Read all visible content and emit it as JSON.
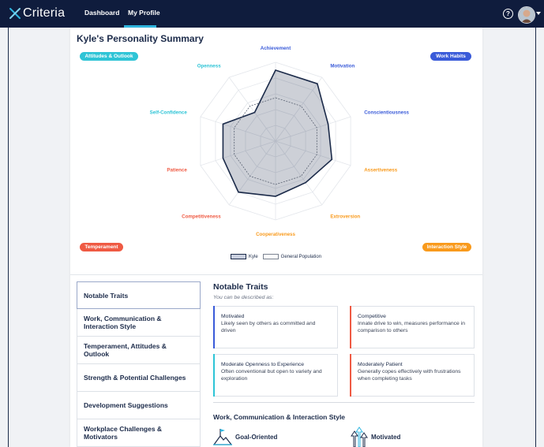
{
  "app": {
    "logo_text": "Criteria",
    "nav": [
      {
        "label": "Dashboard",
        "active": false
      },
      {
        "label": "My Profile",
        "active": true
      }
    ],
    "accent_color": "#2fb6e0",
    "navbar_color": "#0f1c3d"
  },
  "summary": {
    "title": "Kyle's Personality Summary",
    "categories": {
      "attitudes": "Attitudes & Outlook",
      "work_habits": "Work Habits",
      "temperament": "Temperament",
      "interaction": "Interaction Style"
    },
    "category_colors": {
      "attitudes": "#2ec4d6",
      "work_habits": "#3a5bd9",
      "temperament": "#ef5a43",
      "interaction": "#f99a1c"
    },
    "legend": {
      "kyle": "Kyle",
      "population": "General Population"
    }
  },
  "chart_data": {
    "type": "radar",
    "axes": [
      "Achievement",
      "Motivation",
      "Conscientiousness",
      "Assertiveness",
      "Extroversion",
      "Cooperativeness",
      "Competitiveness",
      "Patience",
      "Self-Confidence",
      "Openness"
    ],
    "axis_colors": [
      "#3a5bd9",
      "#3a5bd9",
      "#3a5bd9",
      "#f99a1c",
      "#f99a1c",
      "#f99a1c",
      "#ef5a43",
      "#ef5a43",
      "#2ec4d6",
      "#2ec4d6"
    ],
    "series": [
      {
        "name": "Kyle",
        "values": [
          90,
          90,
          70,
          75,
          65,
          70,
          80,
          70,
          70,
          45
        ]
      },
      {
        "name": "General Population",
        "values": [
          55,
          55,
          55,
          55,
          55,
          55,
          55,
          55,
          55,
          55
        ]
      }
    ],
    "range": [
      0,
      100
    ],
    "rings": 5
  },
  "sidebar": {
    "items": [
      {
        "label": "Notable Traits",
        "active": true
      },
      {
        "label": "Work, Communication & Interaction Style",
        "active": false
      },
      {
        "label": "Temperament, Attitudes & Outlook",
        "active": false
      },
      {
        "label": "Strength & Potential Challenges",
        "active": false
      },
      {
        "label": "Development Suggestions",
        "active": false
      },
      {
        "label": "Workplace Challenges & Motivators",
        "active": false
      }
    ]
  },
  "notable": {
    "title": "Notable Traits",
    "subtitle": "You can be described as:",
    "cards": [
      {
        "title": "Motivated",
        "desc": "Likely seen by others as committed and driven",
        "color": "#3a5bd9"
      },
      {
        "title": "Competitive",
        "desc": "Innate drive to win, measures performance in comparison to others",
        "color": "#ef5a43"
      },
      {
        "title": "Moderate Openness to Experience",
        "desc": "Often conventional but open to variety and exploration",
        "color": "#2ec4d6"
      },
      {
        "title": "Moderately Patient",
        "desc": "Generally copes effectively with frustrations when completing tasks",
        "color": "#ef5a43"
      }
    ]
  },
  "work_style": {
    "title": "Work, Communication & Interaction Style",
    "items": [
      {
        "label": "Goal-Oriented",
        "icon": "flag-mountain-icon"
      },
      {
        "label": "Motivated",
        "icon": "arrows-up-icon"
      }
    ]
  }
}
